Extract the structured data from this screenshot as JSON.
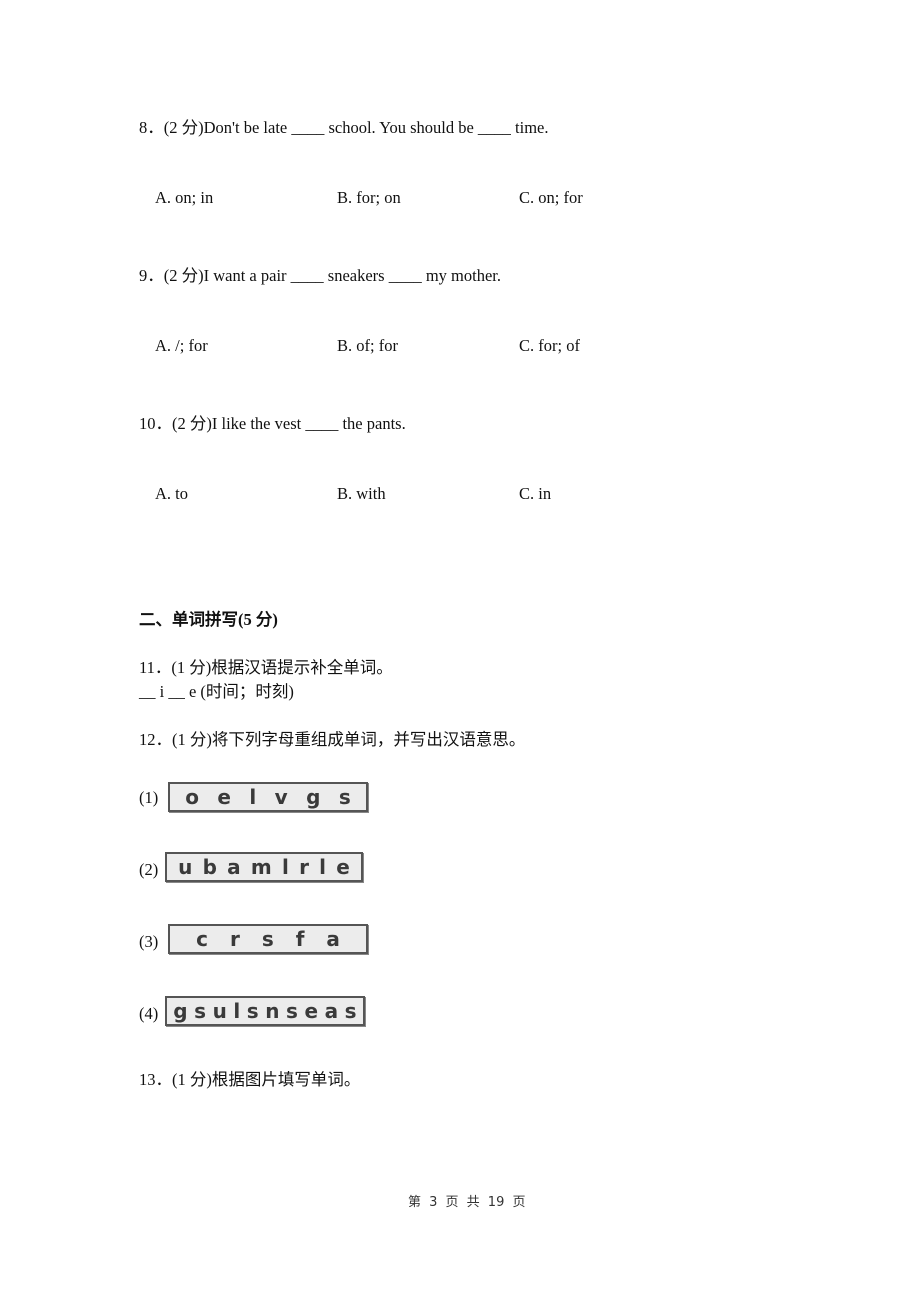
{
  "questions": {
    "q8": {
      "stem": "8．(2 分)Don't be late ____ school. You should be ____ time.",
      "options": [
        "A. on; in",
        "B. for; on",
        "C. on; for"
      ]
    },
    "q9": {
      "stem": "9．(2 分)I want a pair ____ sneakers ____ my mother.",
      "options": [
        "A. /; for",
        "B. of; for",
        "C. for; of"
      ]
    },
    "q10": {
      "stem": "10．(2 分)I like the vest ____ the pants.",
      "options": [
        "A. to",
        "B. with",
        "C. in"
      ]
    }
  },
  "section2": {
    "title": "二、单词拼写(5 分)"
  },
  "q11": {
    "stem": "11．(1 分)根据汉语提示补全单词。",
    "prompt": "__ i __ e (时间；时刻)"
  },
  "q12": {
    "stem": "12．(1 分)将下列字母重组成单词，并写出汉语意思。",
    "items": [
      {
        "label": "(1)",
        "letters": [
          "o",
          "e",
          "l",
          "v",
          "g",
          "s"
        ]
      },
      {
        "label": "(2)",
        "letters": [
          "u",
          "b",
          "a",
          "m",
          "l",
          "r",
          "l",
          "e"
        ]
      },
      {
        "label": "(3)",
        "letters": [
          "c",
          "r",
          "s",
          "f",
          "a"
        ]
      },
      {
        "label": "(4)",
        "letters": [
          "g",
          "s",
          "u",
          "l",
          "s",
          "n",
          "s",
          "e",
          "a",
          "s"
        ]
      }
    ]
  },
  "q13": {
    "stem": "13．(1 分)根据图片填写单词。"
  },
  "footer": {
    "page_text": "第 3 页 共 19 页"
  }
}
